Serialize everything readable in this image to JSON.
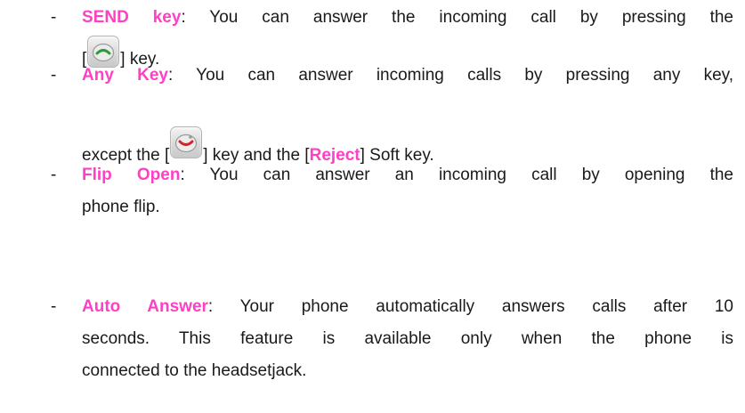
{
  "bullet_symbol": "-",
  "colors": {
    "term": "#ff3fc4",
    "text": "#1a1a1a",
    "send_icon_accent": "#2e9b3a",
    "end_icon_accent": "#d3222a"
  },
  "items": [
    {
      "term": "SEND key",
      "line1_rest": ":  You can answer the incoming call by pressing the",
      "line2_open": "[",
      "icon": "send-key-icon",
      "line2_close": "] key."
    },
    {
      "term": "Any Key",
      "line1_rest": ": You can answer incoming calls by pressing any key,",
      "line2_pre": "except the [",
      "icon": "end-key-icon",
      "line2_mid": "] key and the [",
      "reject": "Reject",
      "line2_post": "] Soft key."
    },
    {
      "term": "Flip Open",
      "line1_rest": ": You can answer an incoming call by opening the",
      "line2": "phone flip."
    },
    {
      "term": "Auto Answer",
      "line1_rest": ": Your phone automatically answers calls after 10",
      "line2": "seconds. This feature is available only when the phone is",
      "line3": "connected to the headsetjack."
    }
  ]
}
